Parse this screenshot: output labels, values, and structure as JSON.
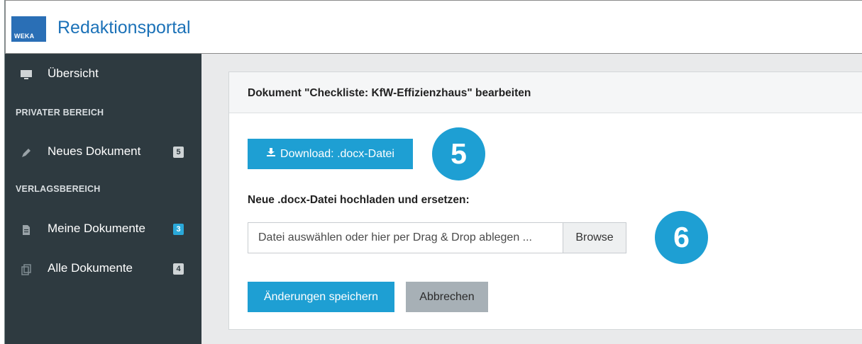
{
  "header": {
    "logo_text": "WEKA",
    "title": "Redaktionsportal"
  },
  "sidebar": {
    "overview": {
      "label": "Übersicht",
      "icon": "monitor-icon"
    },
    "private_section": "PRIVATER BEREICH",
    "new_doc": {
      "label": "Neues Dokument",
      "badge": "5",
      "icon": "pencil-icon"
    },
    "publisher_section": "VERLAGSBEREICH",
    "my_docs": {
      "label": "Meine Dokumente",
      "badge": "3",
      "icon": "document-icon"
    },
    "all_docs": {
      "label": "Alle Dokumente",
      "badge": "4",
      "icon": "copy-icon"
    }
  },
  "card": {
    "title": "Dokument \"Checkliste: KfW-Effizienzhaus\" bearbeiten",
    "download_label": "Download: .docx-Datei",
    "step_download": "5",
    "upload_label": "Neue .docx-Datei hochladen und ersetzen:",
    "file_placeholder": "Datei auswählen oder hier per Drag & Drop ablegen ...",
    "browse_label": "Browse",
    "step_upload": "6",
    "save_label": "Änderungen speichern",
    "cancel_label": "Abbrechen"
  },
  "colors": {
    "accent": "#1e9fd3",
    "sidebar": "#2e3a40",
    "brand": "#1c72b8"
  }
}
